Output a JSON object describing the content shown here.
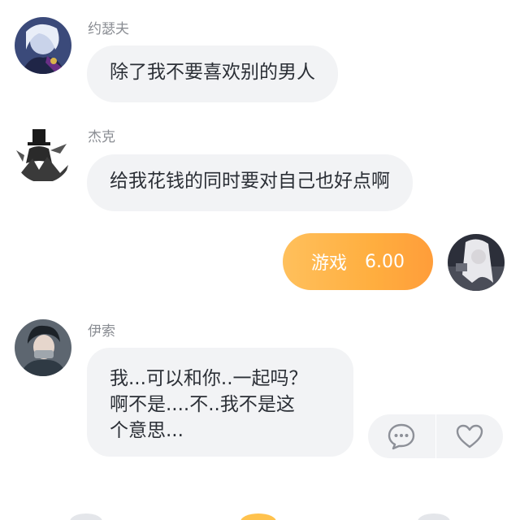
{
  "messages": [
    {
      "sender": "约瑟夫",
      "text": "除了我不要喜欢别的男人"
    },
    {
      "sender": "杰克",
      "text": "给我花钱的同时要对自己也好点啊"
    },
    {
      "gift_label": "游戏",
      "gift_amount": "6.00"
    },
    {
      "sender": "伊索",
      "lines": [
        "我...可以和你..一起吗？",
        "啊不是....不..我不是这",
        "个意思..."
      ]
    }
  ],
  "actions": {
    "comment_icon": "comment-icon",
    "like_icon": "heart-icon"
  },
  "colors": {
    "bubble": "#f2f3f5",
    "name": "#8a8d93",
    "gift_start": "#ffc05c",
    "gift_end": "#ff9d3a"
  }
}
